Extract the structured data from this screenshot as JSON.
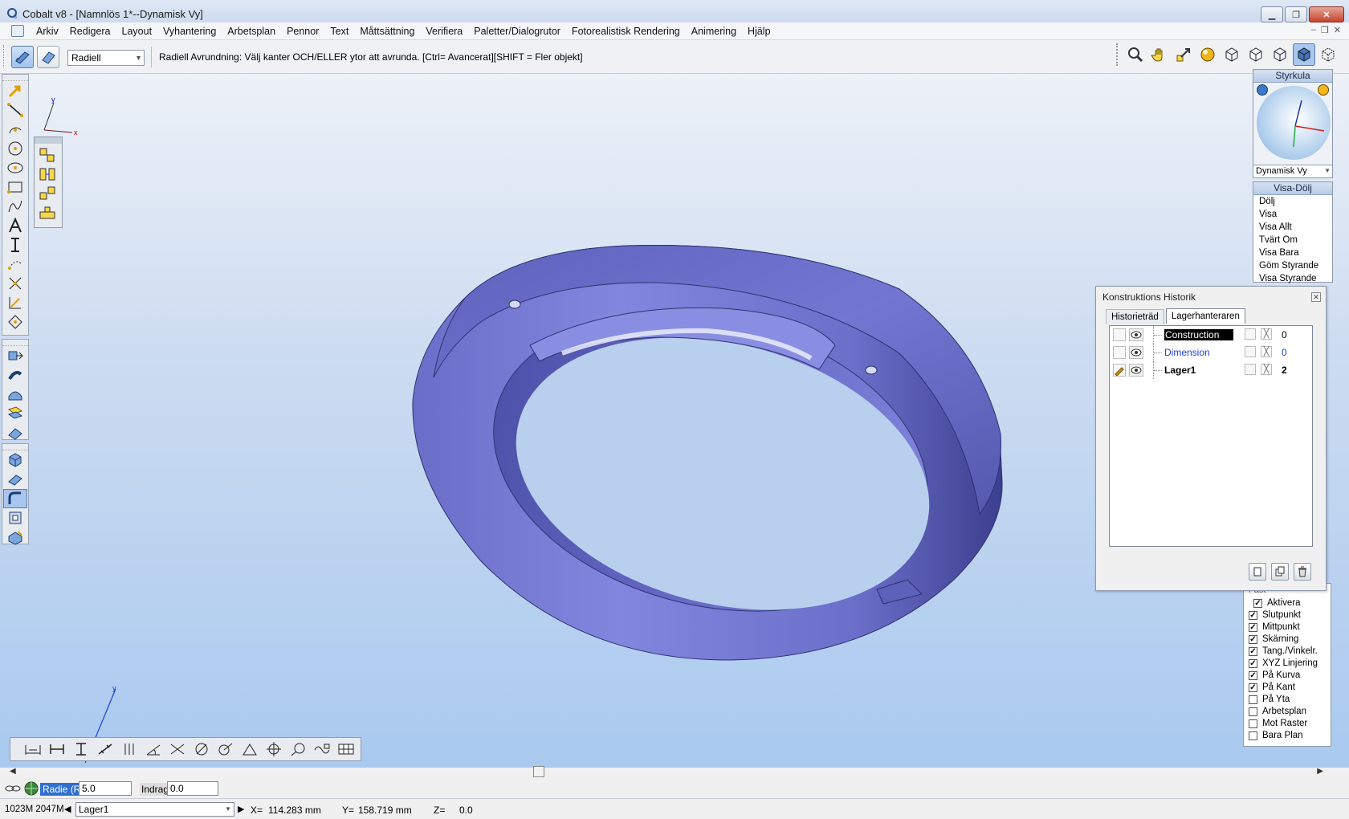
{
  "window": {
    "title": "Cobalt v8 - [Namnlös 1*--Dynamisk Vy]",
    "controls": [
      "minimize",
      "maximize",
      "close"
    ]
  },
  "menu": {
    "items": [
      "Arkiv",
      "Redigera",
      "Layout",
      "Vyhantering",
      "Arbetsplan",
      "Pennor",
      "Text",
      "Måttsättning",
      "Verifiera",
      "Paletter/Dialogrutor",
      "Fotorealistisk Rendering",
      "Animering",
      "Hjälp"
    ]
  },
  "command_bar": {
    "mode_select": "Radiell",
    "prompt": "Radiell Avrundning: Välj kanter OCH/ELLER ytor att avrunda. [Ctrl= Avancerat][SHIFT = Fler objekt]",
    "view_tools": [
      "zoom-icon",
      "pan-hand-icon",
      "zoom-box-icon",
      "render-sphere-icon",
      "iso-view-icon",
      "front-view-icon",
      "side-view-icon",
      "shaded-cube-icon",
      "wire-cube-icon"
    ]
  },
  "axes_label_x": "x",
  "axes_label_y": "y",
  "styrkula": {
    "title": "Styrkula",
    "view_mode": "Dynamisk Vy"
  },
  "visa_dolj": {
    "title": "Visa-Dölj",
    "items": [
      "Dölj",
      "Visa",
      "Visa Allt",
      "Tvärt Om",
      "Visa Bara",
      "Göm Styrande",
      "Visa Styrande"
    ]
  },
  "history": {
    "title": "Konstruktions Historik",
    "tabs": [
      "Historieträd",
      "Lagerhanteraren"
    ],
    "layers": [
      {
        "name": "Construction",
        "count": "0"
      },
      {
        "name": "Dimension",
        "count": "0"
      },
      {
        "name": "Lager1",
        "count": "2"
      }
    ]
  },
  "snap": {
    "header": "Fäst",
    "items": [
      {
        "label": "Aktivera",
        "checked": "✓"
      },
      {
        "label": "Slutpunkt",
        "checked": "✓"
      },
      {
        "label": "Mittpunkt",
        "checked": "✓"
      },
      {
        "label": "Skärning",
        "checked": "✓"
      },
      {
        "label": "Tang./Vinkelr.",
        "checked": "✓"
      },
      {
        "label": "XYZ Linjering",
        "checked": "✓"
      },
      {
        "label": "På Kurva",
        "checked": "✓"
      },
      {
        "label": "På Kant",
        "checked": "✓"
      },
      {
        "label": "På Yta",
        "checked": ""
      },
      {
        "label": "Arbetsplan",
        "checked": ""
      },
      {
        "label": "Mot Raster",
        "checked": ""
      },
      {
        "label": "Bara Plan",
        "checked": ""
      }
    ]
  },
  "input_bar": {
    "radie_label": "Radie (R)",
    "radie_value": "5.0",
    "indrag_label": "Indrag",
    "indrag_value": "0.0"
  },
  "status": {
    "memory": "1023M 2047M",
    "layer": "Lager1",
    "x_label": "X=",
    "x_value": "114.283 mm",
    "y_label": "Y=",
    "y_value": "158.719 mm",
    "z_label": "Z=",
    "z_value": "0.0"
  },
  "colors": {
    "model": "#7b7fd6",
    "model_dark": "#3b3f8f",
    "accent": "#2f6fd3"
  }
}
